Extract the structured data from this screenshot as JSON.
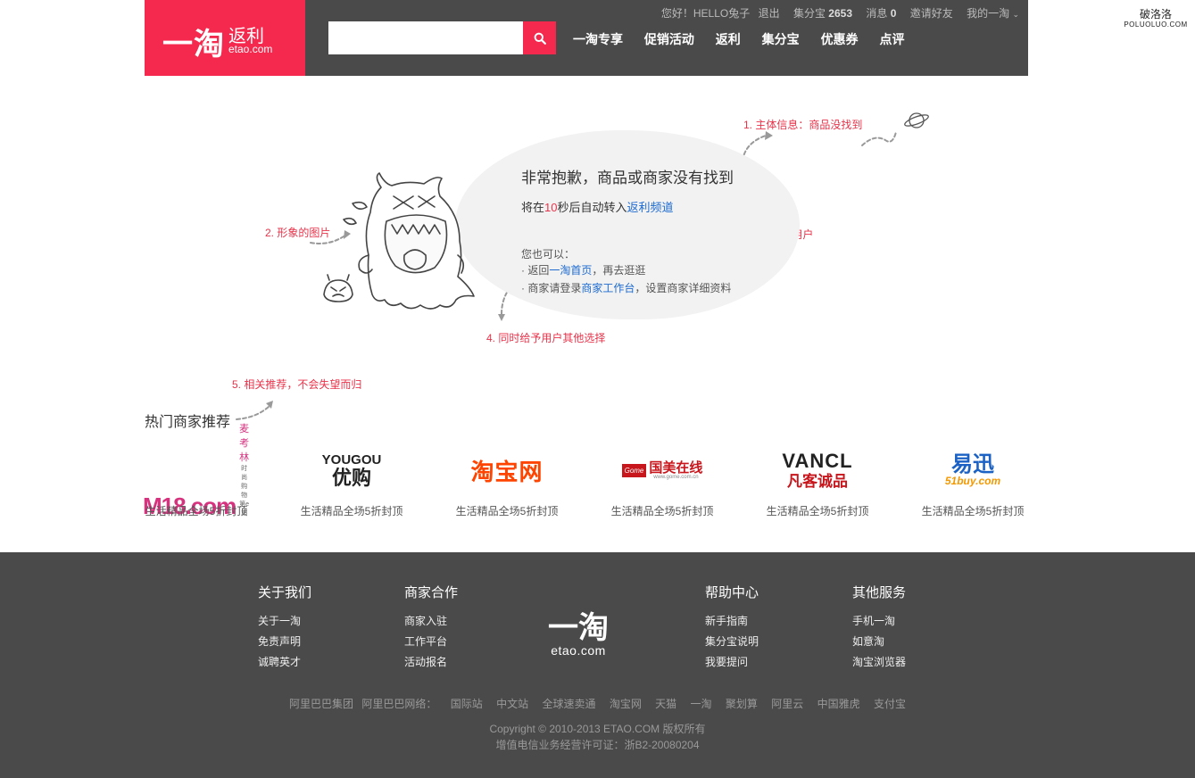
{
  "watermark": {
    "line1": "破洛洛",
    "line2": "POLUOLUO.COM"
  },
  "header": {
    "logo": {
      "main": "一淘",
      "sub": "返利",
      "domain": "etao.com"
    },
    "top_links": {
      "greeting": "您好！HELLO兔子",
      "logout": "退出",
      "points_label": "集分宝",
      "points_value": "2653",
      "messages_label": "消息",
      "messages_value": "0",
      "invite": "邀请好友",
      "my_etao": "我的一淘"
    },
    "search": {
      "placeholder": "",
      "value": ""
    },
    "nav": [
      "一淘专享",
      "促销活动",
      "返利",
      "集分宝",
      "优惠券",
      "点评"
    ]
  },
  "error": {
    "title": "非常抱歉，商品或商家没有找到",
    "redirect_prefix": "将在",
    "redirect_seconds": "10",
    "redirect_middle": "秒后自动转入",
    "redirect_link": "返利频道",
    "also_label": "您也可以：",
    "option1_prefix": "· 返回",
    "option1_link": "一淘首页",
    "option1_suffix": "，再去逛逛",
    "option2_prefix": "· 商家请登录",
    "option2_link": "商家工作台",
    "option2_suffix": "，设置商家详细资料"
  },
  "annotations": {
    "a1": "1. 主体信息：商品没找到",
    "a2": "2. 形象的图片",
    "a3": "3. 适当的引导用户",
    "a4": "4. 同时给予用户其他选择",
    "a5": "5. 相关推荐，不会失望而归"
  },
  "merchants": {
    "title": "热门商家推荐",
    "items": [
      {
        "logo_text": "M18.com",
        "logo_sub": "麦考林",
        "logo_tag": "时尚购物第e站",
        "desc": "生活精品全场5折封顶",
        "color": "#d6337f"
      },
      {
        "logo_text": "YOUGOU",
        "logo_sub": "优购",
        "desc": "生活精品全场5折封顶",
        "color": "#222222"
      },
      {
        "logo_text": "淘宝网",
        "desc": "生活精品全场5折封顶",
        "color": "#ff4400"
      },
      {
        "logo_text": "国美在线",
        "logo_tag": "www.gome.com.cn",
        "logo_badge": "Gome",
        "desc": "生活精品全场5折封顶",
        "color": "#c8161d"
      },
      {
        "logo_text": "VANCL",
        "logo_sub": "凡客诚品",
        "desc": "生活精品全场5折封顶",
        "color": "#222222"
      },
      {
        "logo_text": "易迅",
        "logo_sub": "51buy.com",
        "desc": "生活精品全场5折封顶",
        "color": "#1b62c4"
      }
    ]
  },
  "footer": {
    "columns": [
      {
        "title": "关于我们",
        "links": [
          "关于一淘",
          "免责声明",
          "诚聘英才"
        ]
      },
      {
        "title": "商家合作",
        "links": [
          "商家入驻",
          "工作平台",
          "活动报名"
        ]
      },
      {
        "title": "帮助中心",
        "links": [
          "新手指南",
          "集分宝说明",
          "我要提问"
        ]
      },
      {
        "title": "其他服务",
        "links": [
          "手机一淘",
          "如意淘",
          "淘宝浏览器"
        ]
      }
    ],
    "logo": {
      "main": "一淘",
      "domain": "etao.com"
    },
    "links": [
      "阿里巴巴集团",
      "阿里巴巴网络：",
      "国际站",
      "中文站",
      "全球速卖通",
      "淘宝网",
      "天猫",
      "一淘",
      "聚划算",
      "阿里云",
      "中国雅虎",
      "支付宝"
    ],
    "copyright": "Copyright © 2010-2013 ETAO.COM 版权所有",
    "license": "增值电信业务经营许可证：浙B2-20080204"
  }
}
